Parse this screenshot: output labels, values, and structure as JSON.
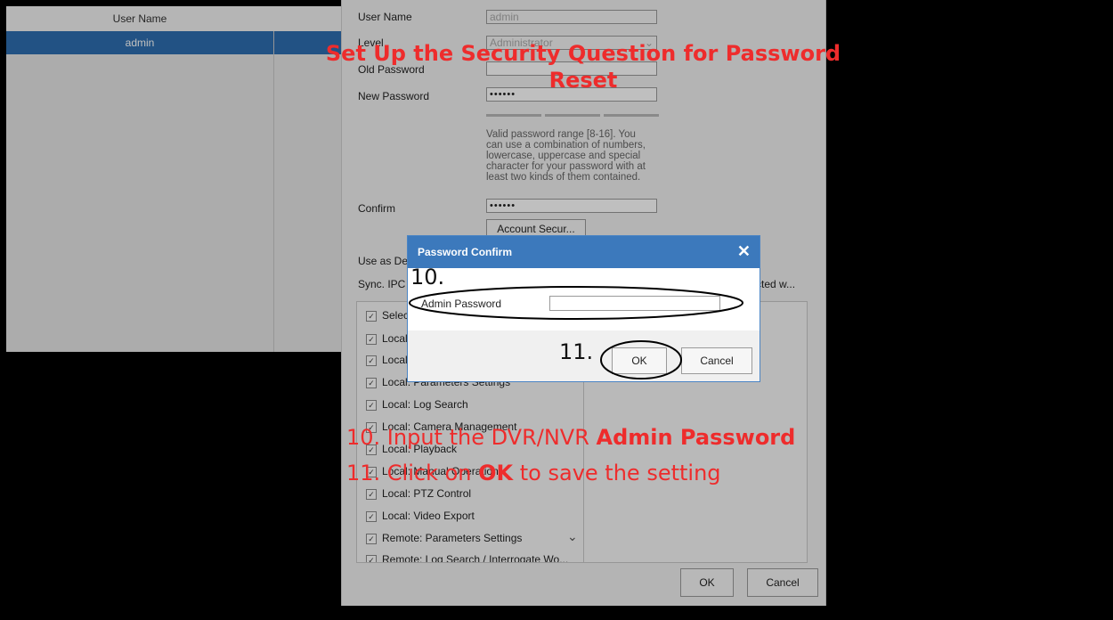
{
  "background_list": {
    "header": "User Name",
    "selected_row": "admin"
  },
  "edit_user": {
    "user_name_label": "User Name",
    "user_name_value": "admin",
    "level_label": "Level",
    "level_value": "Administrator",
    "old_password_label": "Old Password",
    "new_password_label": "New Password",
    "new_password_value": "••••••",
    "password_hint": "Valid password range [8-16]. You can use a combination of numbers, lowercase, uppercase and special character for your password with at least two kinds of them contained.",
    "confirm_label": "Confirm",
    "confirm_value": "••••••",
    "account_security_button": "Account Secur...",
    "use_as_default_label": "Use as De",
    "sync_ipc_label": "Sync. IPC",
    "sync_ipc_right": "cted w...",
    "select_all_label": "Selec",
    "permissions": [
      "Local",
      "Local",
      "Local: Parameters Settings",
      "Local: Log Search",
      "Local: Camera Management",
      "Local: Playback",
      "Local: Manual Operation",
      "Local: PTZ Control",
      "Local: Video Export",
      "Remote: Parameters Settings",
      "Remote: Log Search / Interrogate Wo..."
    ],
    "ok_button": "OK",
    "cancel_button": "Cancel"
  },
  "password_confirm": {
    "title": "Password Confirm",
    "close_symbol": "✕",
    "admin_password_label": "Admin Password",
    "admin_password_value": "",
    "ok_button": "OK",
    "cancel_button": "Cancel"
  },
  "annotations": {
    "title": "Set Up the Security Question for Password Reset",
    "step10_marker": "10.",
    "step11_marker": "11.",
    "step10_prefix": "10. Input the DVR/NVR ",
    "step10_bold": "Admin Password",
    "step11_prefix": "11. Click on ",
    "step11_bold": "OK",
    "step11_suffix": " to save the setting",
    "annotation_color": "#ee2c2c"
  }
}
